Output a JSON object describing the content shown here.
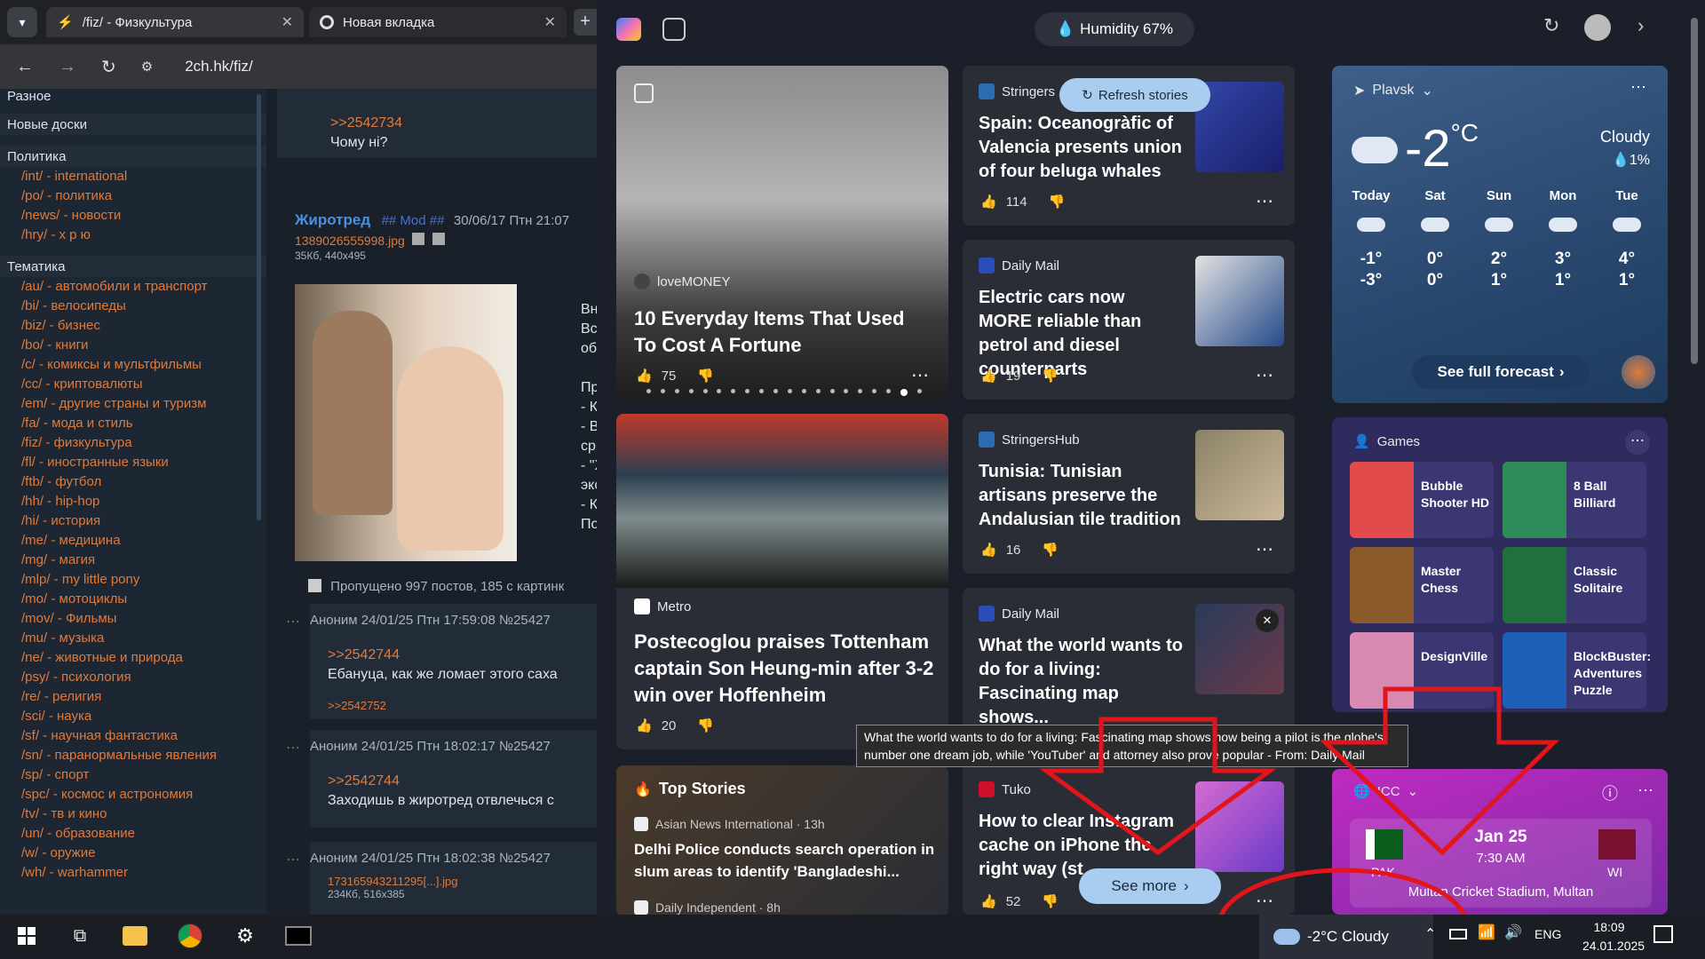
{
  "browser": {
    "tabs": [
      {
        "label": "/fiz/ - Физкультура"
      },
      {
        "label": "Новая вкладка"
      }
    ],
    "url": "2ch.hk/fiz/"
  },
  "sidebar": {
    "top_item": "Разное",
    "sections": [
      {
        "title": "Новые доски",
        "links": []
      },
      {
        "title": "Политика",
        "links": [
          "/int/ - international",
          "/po/ - политика",
          "/news/ - новости",
          "/hry/ - х р ю"
        ]
      },
      {
        "title": "Тематика",
        "links": [
          "/au/ - автомобили и транспорт",
          "/bi/ - велосипеды",
          "/biz/ - бизнес",
          "/bo/ - книги",
          "/c/ - комиксы и мультфильмы",
          "/cc/ - криптовалюты",
          "/em/ - другие страны и туризм",
          "/fa/ - мода и стиль",
          "/fiz/ - физкультура",
          "/fl/ - иностранные языки",
          "/ftb/ - футбол",
          "/hh/ - hip-hop",
          "/hi/ - история",
          "/me/ - медицина",
          "/mg/ - магия",
          "/mlp/ - my little pony",
          "/mo/ - мотоциклы",
          "/mov/ - Фильмы",
          "/mu/ - музыка",
          "/ne/ - животные и природа",
          "/psy/ - психология",
          "/re/ - религия",
          "/sci/ - наука",
          "/sf/ - научная фантастика",
          "/sn/ - паранормальные явления",
          "/sp/ - спорт",
          "/spc/ - космос и астрономия",
          "/tv/ - тв и кино",
          "/un/ - образование",
          "/w/ - оружие",
          "/wh/ - warhammer"
        ]
      }
    ]
  },
  "thread": {
    "top_reply": ">>2542734",
    "top_text": "Чому ні?",
    "op": {
      "name": "Жиротред",
      "mod": "## Mod ##",
      "date": "30/06/17 Птн 21:07",
      "file": "1389026555998.jpg",
      "filemeta": "35Кб, 440x495",
      "side_text": [
        "Вни",
        "Всё",
        "обе",
        "",
        "Про",
        "- Ко",
        "- Вь",
        "срь",
        "- \"Х",
        "экс",
        "- Ко",
        "Пон"
      ]
    },
    "skipped": "Пропущено 997 постов, 185 с картинк",
    "posts": [
      {
        "meta": "Аноним 24/01/25 Птн 17:59:08 №25427",
        "reply": ">>2542744",
        "text": "Ебануца, как же ломает этого саха",
        "backlink": ">>2542752"
      },
      {
        "meta": "Аноним 24/01/25 Птн 18:02:17 №25427",
        "reply": ">>2542744",
        "text": "Заходишь в жиротред отвлечься с"
      },
      {
        "meta": "Аноним 24/01/25 Птн 18:02:38 №25427",
        "file": "173165943211295[...].jpg",
        "filemeta": "234Кб, 516x385"
      }
    ]
  },
  "msn": {
    "humidity": "Humidity 67%",
    "refresh": "Refresh stories",
    "see_more": "See more",
    "hero": {
      "source": "loveMONEY",
      "headline": "10 Everyday Items That Used To Cost A Fortune",
      "likes": "75"
    },
    "metro": {
      "source": "Metro",
      "headline": "Postecoglou praises Tottenham captain Son Heung-min after 3-2 win over Hoffenheim",
      "likes": "20"
    },
    "top_stories": {
      "title": "Top Stories",
      "items": [
        {
          "source": "Asian News International · 13h",
          "headline": "Delhi Police conducts search operation in slum areas to identify 'Bangladeshi..."
        },
        {
          "source": "Daily Independent · 8h"
        }
      ]
    },
    "stories": [
      {
        "source": "Stringers",
        "headline": "Spain: Oceanogràfic of Valencia presents union of four beluga whales",
        "likes": "114"
      },
      {
        "source": "Daily Mail",
        "headline": "Electric cars now MORE reliable than petrol and diesel counterparts",
        "likes": "19"
      },
      {
        "source": "StringersHub",
        "headline": "Tunisia: Tunisian artisans preserve the Andalusian tile tradition",
        "likes": "16"
      },
      {
        "source": "Daily Mail",
        "headline": "What the world wants to do for a living: Fascinating map shows..."
      },
      {
        "source": "Tuko",
        "headline": "How to clear Instagram cache on iPhone the right way (st",
        "likes": "52"
      }
    ],
    "tooltip": "What the world wants to do for a living: Fascinating map shows how being a pilot is the globe's number one dream job, while 'YouTuber' and attorney also prove popular - From: Daily Mail",
    "weather": {
      "location": "Plavsk",
      "temp": "-2",
      "unit": "°C",
      "condition": "Cloudy",
      "precip": "1%",
      "days": [
        {
          "name": "Today",
          "hi": "-1°",
          "lo": "-3°"
        },
        {
          "name": "Sat",
          "hi": "0°",
          "lo": "0°"
        },
        {
          "name": "Sun",
          "hi": "2°",
          "lo": "1°"
        },
        {
          "name": "Mon",
          "hi": "3°",
          "lo": "1°"
        },
        {
          "name": "Tue",
          "hi": "4°",
          "lo": "1°"
        }
      ],
      "forecast_btn": "See full forecast"
    },
    "games": {
      "title": "Games",
      "items": [
        "Bubble Shooter HD",
        "8 Ball Billiard",
        "Master Chess",
        "Classic Solitaire",
        "DesignVille",
        "BlockBuster: Adventures Puzzle"
      ]
    },
    "cricket": {
      "title": "ICC",
      "date": "Jan 25",
      "time": "7:30 AM",
      "team1": "PAK",
      "team2": "WI",
      "venue": "Multan Cricket Stadium, Multan"
    }
  },
  "taskbar": {
    "weather": "-2°C  Cloudy",
    "lang": "ENG",
    "time": "18:09",
    "date": "24.01.2025"
  },
  "colors": {
    "accent": "#e07a3a",
    "annotation": "#e4141b"
  }
}
